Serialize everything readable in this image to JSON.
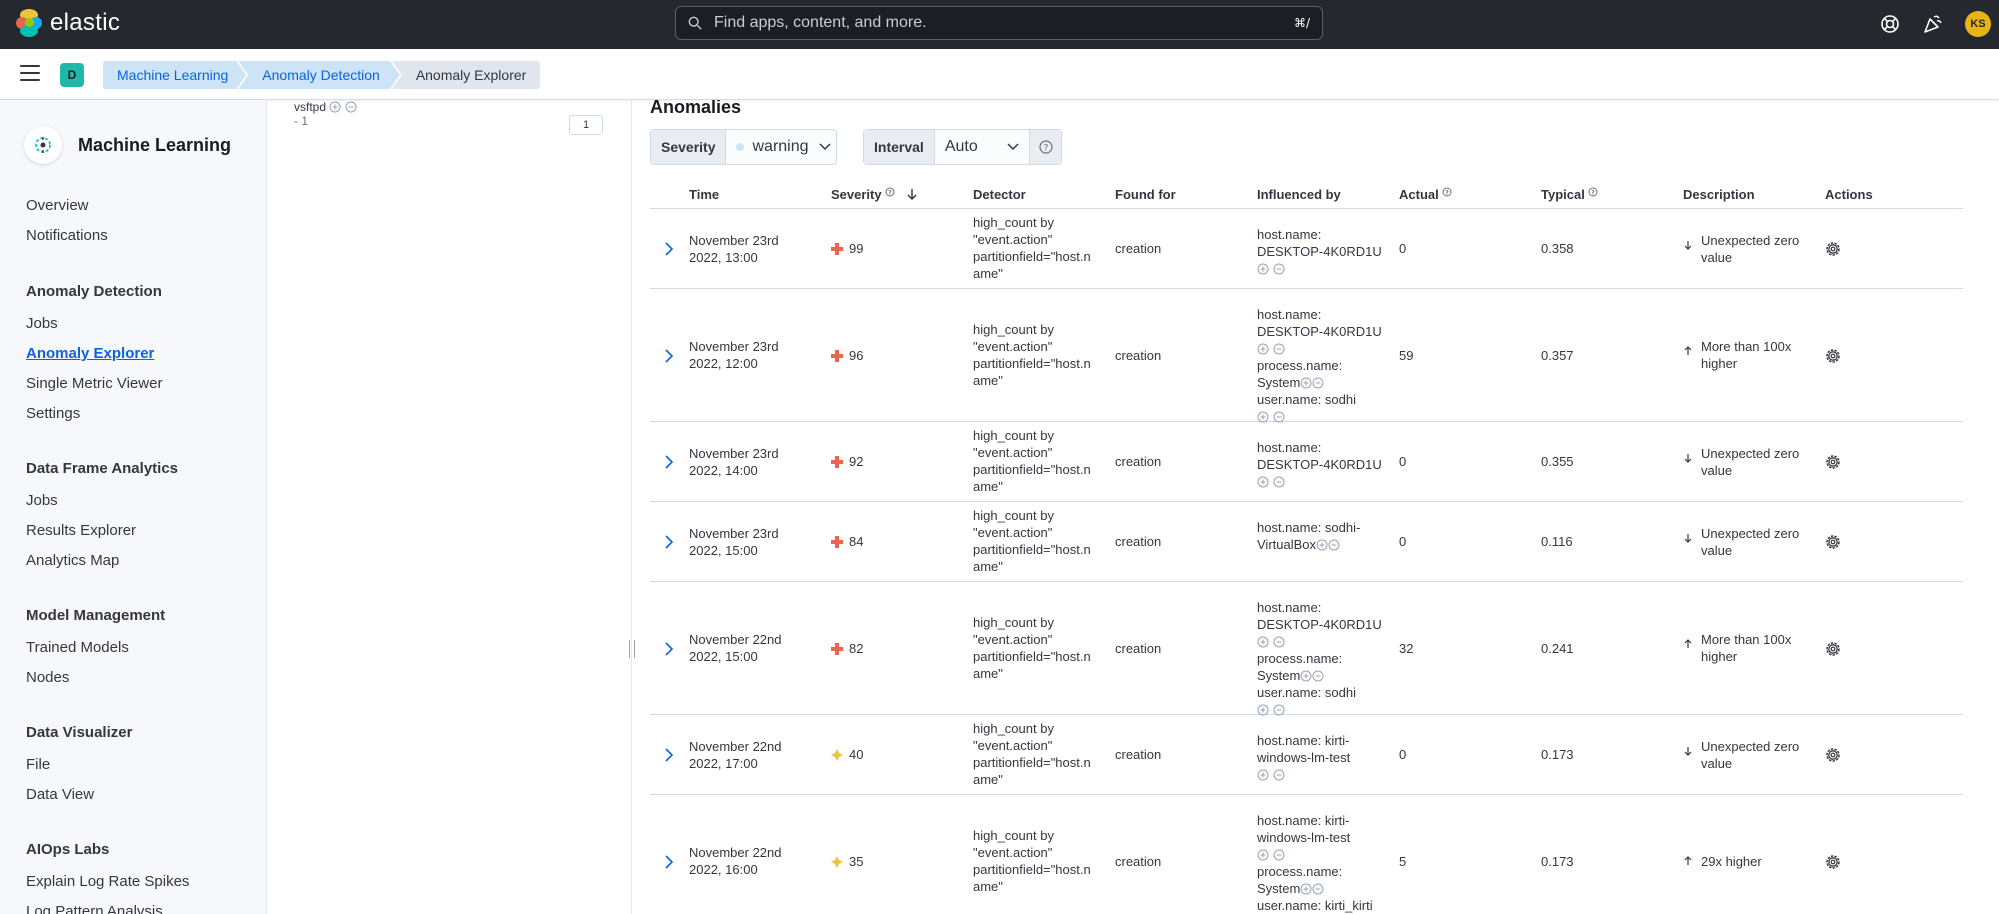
{
  "brand": {
    "name": "elastic"
  },
  "search": {
    "placeholder": "Find apps, content, and more.",
    "shortcut": "⌘/"
  },
  "user": {
    "initials": "KS"
  },
  "space": {
    "initial": "D"
  },
  "breadcrumbs": [
    "Machine Learning",
    "Anomaly Detection",
    "Anomaly Explorer"
  ],
  "sidebar": {
    "title": "Machine Learning",
    "groups": [
      {
        "title": "",
        "items": [
          "Overview",
          "Notifications"
        ]
      },
      {
        "title": "Anomaly Detection",
        "items": [
          "Jobs",
          "Anomaly Explorer",
          "Single Metric Viewer",
          "Settings"
        ]
      },
      {
        "title": "Data Frame Analytics",
        "items": [
          "Jobs",
          "Results Explorer",
          "Analytics Map"
        ]
      },
      {
        "title": "Model Management",
        "items": [
          "Trained Models",
          "Nodes"
        ]
      },
      {
        "title": "Data Visualizer",
        "items": [
          "File",
          "Data View"
        ]
      },
      {
        "title": "AIOps Labs",
        "items": [
          "Explain Log Rate Spikes",
          "Log Pattern Analysis"
        ]
      }
    ]
  },
  "middle": {
    "text1": "vsftpd",
    "text2": "- 1",
    "badge": "1"
  },
  "anomalies": {
    "title": "Anomalies",
    "severity_label": "Severity",
    "severity_value": "warning",
    "interval_label": "Interval",
    "interval_value": "Auto",
    "columns": [
      "Time",
      "Severity",
      "Detector",
      "Found for",
      "Influenced by",
      "Actual",
      "Typical",
      "Description",
      "Actions"
    ],
    "rows": [
      {
        "time": [
          "November 23rd",
          "2022, 13:00"
        ],
        "severity": "99",
        "level": "critical",
        "detector": [
          "high_count by",
          "\"event.action\"",
          "partitionfield=\"host.n",
          "ame\""
        ],
        "found_for": "creation",
        "influencers": [
          [
            "host.name:",
            "DESKTOP-4K0RD1U"
          ]
        ],
        "actual": "0",
        "typical": "0.358",
        "direction": "down",
        "description": [
          "Unexpected zero",
          "value"
        ]
      },
      {
        "time": [
          "November 23rd",
          "2022, 12:00"
        ],
        "severity": "96",
        "level": "critical",
        "detector": [
          "high_count by",
          "\"event.action\"",
          "partitionfield=\"host.n",
          "ame\""
        ],
        "found_for": "creation",
        "influencers": [
          [
            "host.name:",
            "DESKTOP-4K0RD1U"
          ],
          [
            "process.name:",
            "System"
          ],
          [
            "user.name: sodhi"
          ]
        ],
        "actual": "59",
        "typical": "0.357",
        "direction": "up",
        "description": [
          "More than 100x",
          "higher"
        ]
      },
      {
        "time": [
          "November 23rd",
          "2022, 14:00"
        ],
        "severity": "92",
        "level": "critical",
        "detector": [
          "high_count by",
          "\"event.action\"",
          "partitionfield=\"host.n",
          "ame\""
        ],
        "found_for": "creation",
        "influencers": [
          [
            "host.name:",
            "DESKTOP-4K0RD1U"
          ]
        ],
        "actual": "0",
        "typical": "0.355",
        "direction": "down",
        "description": [
          "Unexpected zero",
          "value"
        ]
      },
      {
        "time": [
          "November 23rd",
          "2022, 15:00"
        ],
        "severity": "84",
        "level": "critical",
        "detector": [
          "high_count by",
          "\"event.action\"",
          "partitionfield=\"host.n",
          "ame\""
        ],
        "found_for": "creation",
        "influencers": [
          [
            "host.name: sodhi-",
            "VirtualBox"
          ]
        ],
        "actual": "0",
        "typical": "0.116",
        "direction": "down",
        "description": [
          "Unexpected zero",
          "value"
        ]
      },
      {
        "time": [
          "November 22nd",
          "2022, 15:00"
        ],
        "severity": "82",
        "level": "critical",
        "detector": [
          "high_count by",
          "\"event.action\"",
          "partitionfield=\"host.n",
          "ame\""
        ],
        "found_for": "creation",
        "influencers": [
          [
            "host.name:",
            "DESKTOP-4K0RD1U"
          ],
          [
            "process.name:",
            "System"
          ],
          [
            "user.name: sodhi"
          ]
        ],
        "actual": "32",
        "typical": "0.241",
        "direction": "up",
        "description": [
          "More than 100x",
          "higher"
        ]
      },
      {
        "time": [
          "November 22nd",
          "2022, 17:00"
        ],
        "severity": "40",
        "level": "warning",
        "detector": [
          "high_count by",
          "\"event.action\"",
          "partitionfield=\"host.n",
          "ame\""
        ],
        "found_for": "creation",
        "influencers": [
          [
            "host.name: kirti-",
            "windows-lm-test"
          ]
        ],
        "actual": "0",
        "typical": "0.173",
        "direction": "down",
        "description": [
          "Unexpected zero",
          "value"
        ]
      },
      {
        "time": [
          "November 22nd",
          "2022, 16:00"
        ],
        "severity": "35",
        "level": "warning",
        "detector": [
          "high_count by",
          "\"event.action\"",
          "partitionfield=\"host.n",
          "ame\""
        ],
        "found_for": "creation",
        "influencers": [
          [
            "host.name: kirti-",
            "windows-lm-test"
          ],
          [
            "process.name:",
            "System"
          ],
          [
            "user.name: kirti_kirti"
          ]
        ],
        "actual": "5",
        "typical": "0.173",
        "direction": "up",
        "description": [
          "29x higher"
        ]
      }
    ]
  },
  "colors": {
    "critical": "#e7664c",
    "warning": "#f0c33c",
    "link": "#0b64dd"
  }
}
